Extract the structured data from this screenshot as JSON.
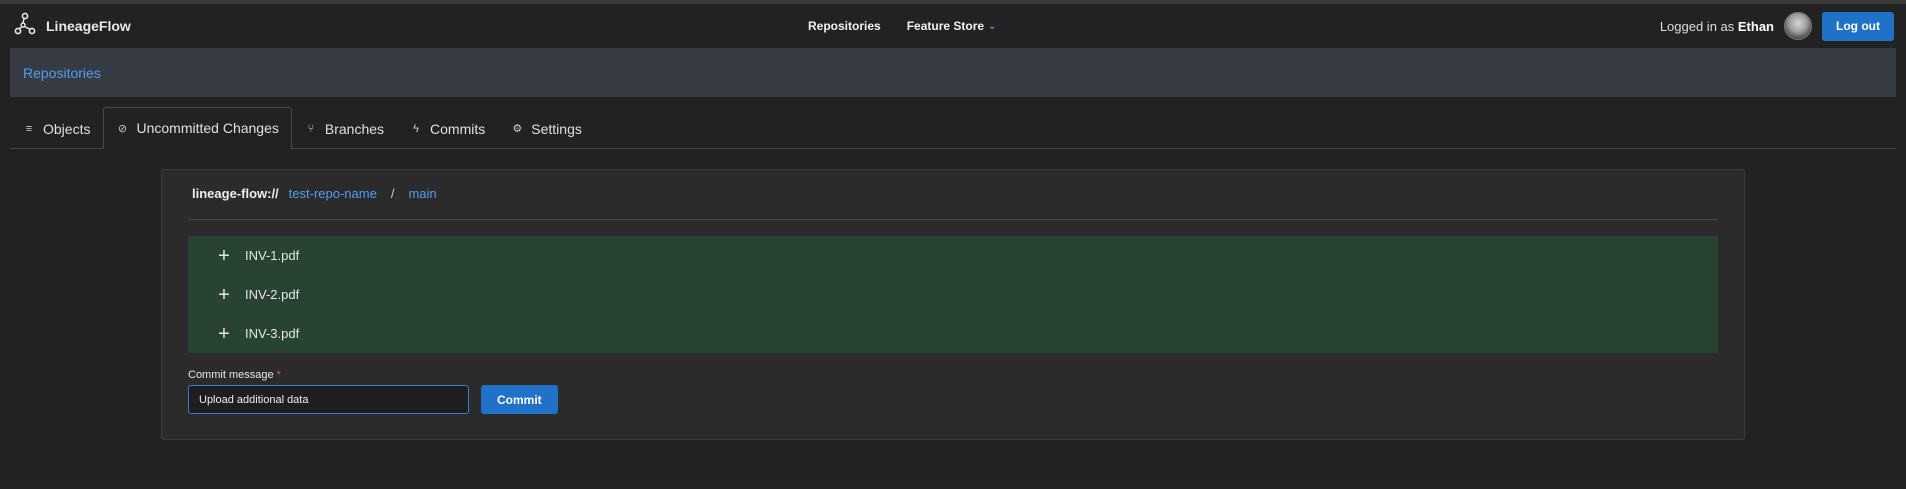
{
  "app": {
    "name": "LineageFlow",
    "logo_icon": "lineage-graph-icon"
  },
  "nav": {
    "repositories": "Repositories",
    "feature_store": "Feature Store"
  },
  "user": {
    "logged_in_prefix": "Logged in as",
    "name": "Ethan",
    "logout_label": "Log out"
  },
  "breadcrumb": {
    "repositories": "Repositories"
  },
  "tabs": [
    {
      "label": "Objects",
      "icon": "database-icon",
      "glyph": "≡"
    },
    {
      "label": "Uncommitted Changes",
      "icon": "circle-slash-icon",
      "glyph": "⊘"
    },
    {
      "label": "Branches",
      "icon": "git-branch-icon",
      "glyph": "⑂"
    },
    {
      "label": "Commits",
      "icon": "git-commit-icon",
      "glyph": "ϟ"
    },
    {
      "label": "Settings",
      "icon": "gear-icon",
      "glyph": "⚙"
    }
  ],
  "active_tab": "Uncommitted Changes",
  "path": {
    "protocol": "lineage-flow://",
    "repo": "test-repo-name",
    "separator": "/",
    "branch": "main"
  },
  "changes": [
    {
      "type": "added",
      "symbol": "+",
      "name": "INV-1.pdf"
    },
    {
      "type": "added",
      "symbol": "+",
      "name": "INV-2.pdf"
    },
    {
      "type": "added",
      "symbol": "+",
      "name": "INV-3.pdf"
    }
  ],
  "commit": {
    "label": "Commit message",
    "required_mark": "*",
    "value": "Upload additional data",
    "button_label": "Commit"
  },
  "colors": {
    "accent": "#1f72c8",
    "link": "#4d9ef0",
    "added_bg": "#294333",
    "background": "#222222"
  }
}
